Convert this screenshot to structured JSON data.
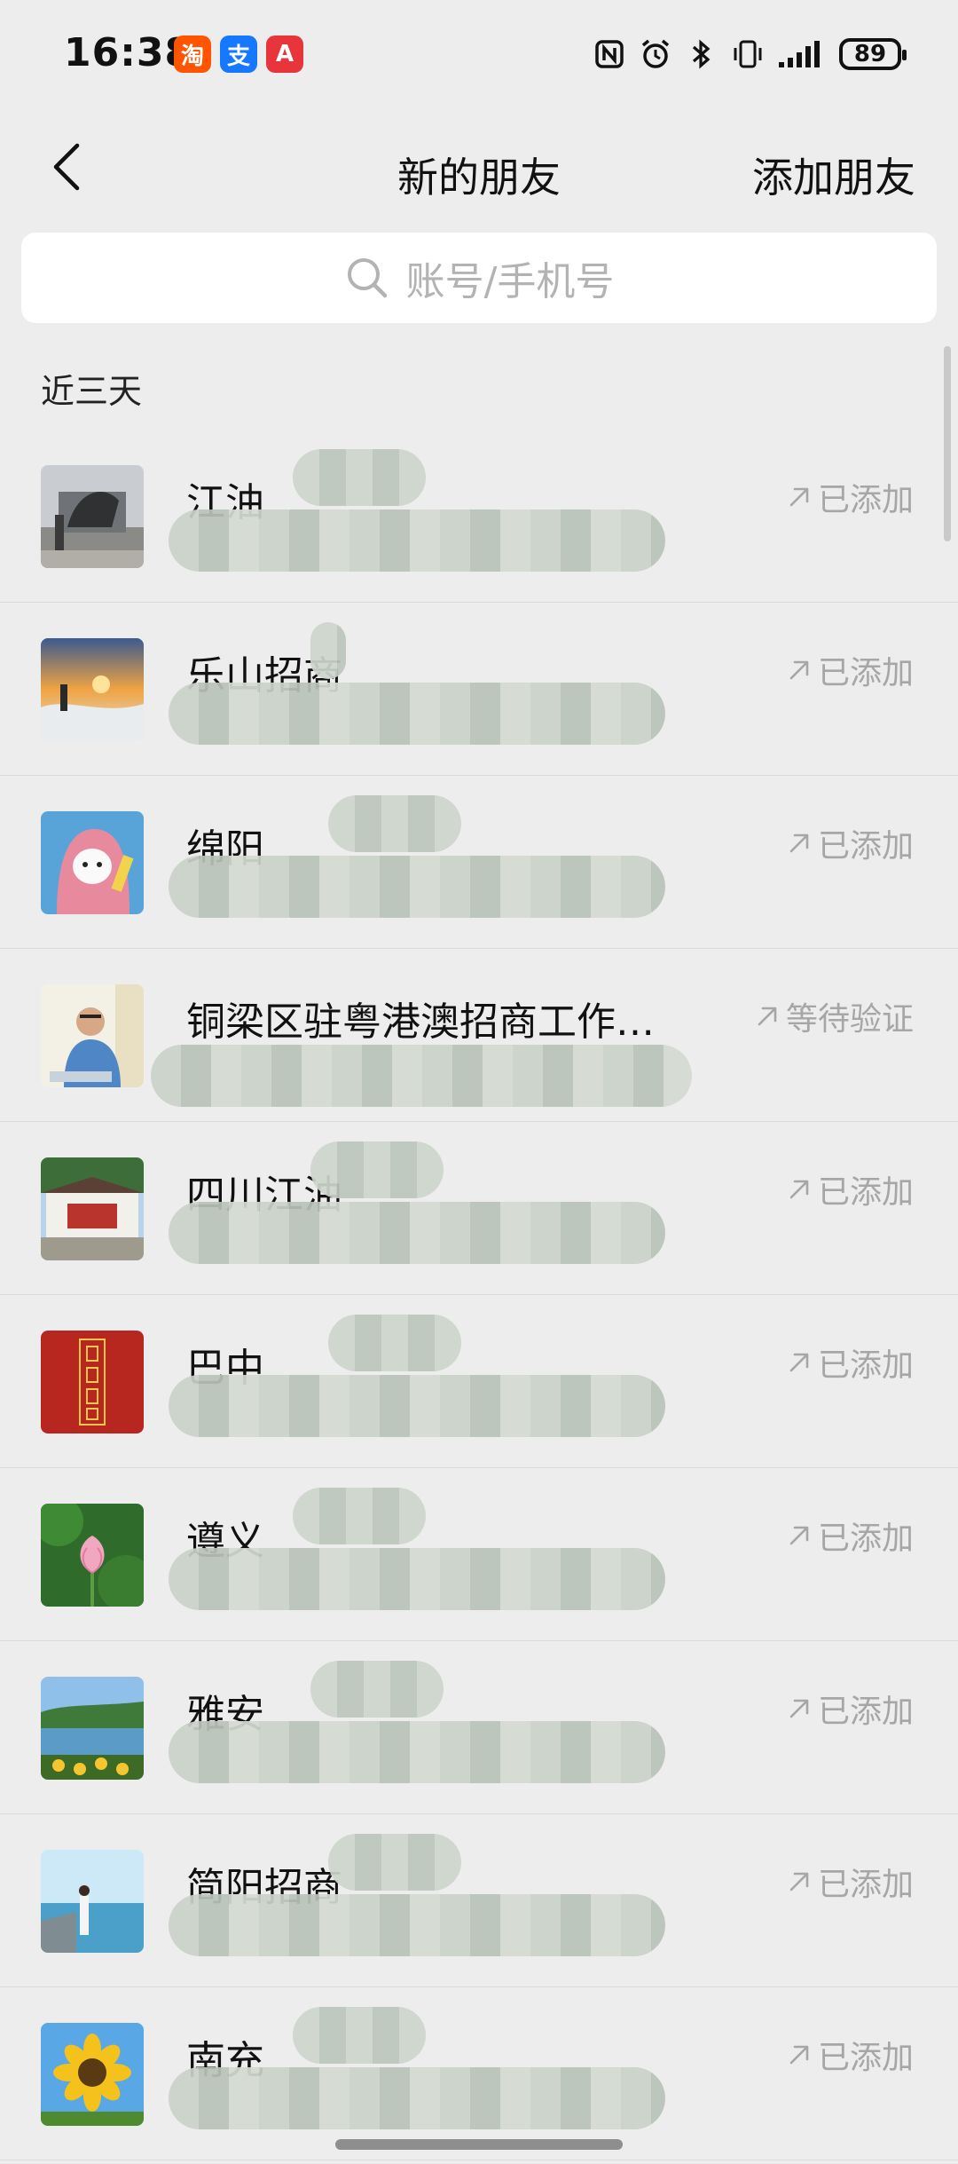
{
  "status_bar": {
    "time": "16:38",
    "apps": [
      {
        "name": "taobao-icon",
        "glyph": "淘",
        "color": "#ff5500"
      },
      {
        "name": "alipay-icon",
        "glyph": "支",
        "color": "#1677ff"
      },
      {
        "name": "app-gallery-icon",
        "glyph": "A",
        "color": "#e8353b"
      }
    ],
    "battery": "89"
  },
  "nav": {
    "title": "新的朋友",
    "action": "添加朋友"
  },
  "search": {
    "placeholder": "账号/手机号"
  },
  "section": {
    "title": "近三天"
  },
  "contacts": [
    {
      "name": "江油",
      "status": "已添加",
      "avatar": "statue"
    },
    {
      "name": "乐山招商",
      "status": "已添加",
      "avatar": "sunset"
    },
    {
      "name": "绵阳",
      "status": "已添加",
      "avatar": "cat"
    },
    {
      "name": "铜梁区驻粤港澳招商工作…",
      "status": "等待验证",
      "avatar": "man"
    },
    {
      "name": "四川江油",
      "status": "已添加",
      "avatar": "gate"
    },
    {
      "name": "巴中",
      "status": "已添加",
      "avatar": "seal"
    },
    {
      "name": "遵义",
      "status": "已添加",
      "avatar": "lotus"
    },
    {
      "name": "雅安",
      "status": "已添加",
      "avatar": "lake"
    },
    {
      "name": "简阳招商",
      "status": "已添加",
      "avatar": "beach"
    },
    {
      "name": "南充",
      "status": "已添加",
      "avatar": "sunflower"
    }
  ],
  "colors": {
    "background": "#ededed",
    "secondary_text": "#a6a6a6"
  }
}
